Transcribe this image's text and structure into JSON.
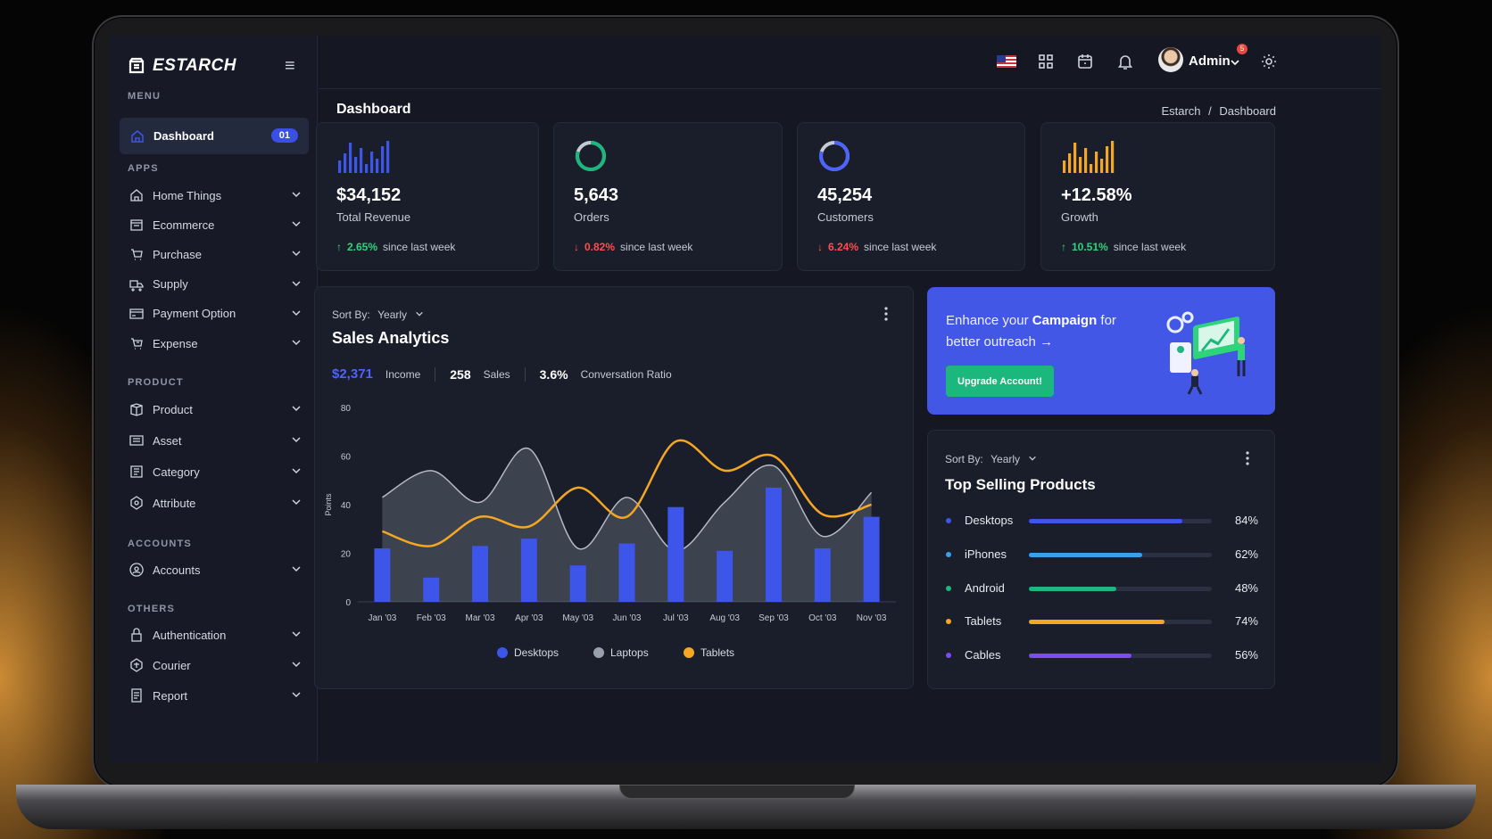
{
  "app": {
    "brand": "ESTARCH"
  },
  "sidebar": {
    "menu_label": "MENU",
    "dashboard": {
      "label": "Dashboard",
      "badge": "01"
    },
    "apps_label": "APPS",
    "apps": [
      "Home Things",
      "Ecommerce",
      "Purchase",
      "Supply",
      "Payment Option",
      "Expense"
    ],
    "product_label": "PRODUCT",
    "product": [
      "Product",
      "Asset",
      "Category",
      "Attribute"
    ],
    "accounts_label": "ACCOUNTS",
    "accounts": [
      "Accounts"
    ],
    "others_label": "OTHERS",
    "others": [
      "Authentication",
      "Courier",
      "Report"
    ]
  },
  "topbar": {
    "notification_count": "5",
    "user_name": "Admin"
  },
  "page": {
    "title": "Dashboard",
    "breadcrumb": {
      "root": "Estarch",
      "sep": "/",
      "current": "Dashboard"
    }
  },
  "stats": [
    {
      "value": "$34,152",
      "label": "Total Revenue",
      "change": "2.65%",
      "direction": "up",
      "suffix": "since last week",
      "icon": "bar-chart-icon"
    },
    {
      "value": "5,643",
      "label": "Orders",
      "change": "0.82%",
      "direction": "down",
      "suffix": "since last week",
      "icon": "donut-icon"
    },
    {
      "value": "45,254",
      "label": "Customers",
      "change": "6.24%",
      "direction": "down",
      "suffix": "since last week",
      "icon": "donut-icon"
    },
    {
      "value": "+12.58%",
      "label": "Growth",
      "change": "10.51%",
      "direction": "up",
      "suffix": "since last week",
      "icon": "bar-chart-icon"
    }
  ],
  "sales": {
    "sort_label": "Sort By:",
    "sort_value": "Yearly",
    "title": "Sales Analytics",
    "income_value": "$2,371",
    "income_label": "Income",
    "sales_value": "258",
    "sales_label": "Sales",
    "ratio_value": "3.6%",
    "ratio_label": "Conversation Ratio"
  },
  "chart_data": {
    "type": "bar",
    "ylabel": "Points",
    "ylim": [
      0,
      80
    ],
    "yticks": [
      0,
      20,
      40,
      60,
      80
    ],
    "categories": [
      "Jan '03",
      "Feb '03",
      "Mar '03",
      "Apr '03",
      "May '03",
      "Jun '03",
      "Jul '03",
      "Aug '03",
      "Sep '03",
      "Oct '03",
      "Nov '03"
    ],
    "series": [
      {
        "name": "Desktops",
        "type": "bar",
        "color": "#3d55e8",
        "values": [
          22,
          10,
          23,
          26,
          15,
          24,
          39,
          21,
          47,
          22,
          35
        ]
      },
      {
        "name": "Laptops",
        "type": "area",
        "color": "#9aa0ad",
        "values": [
          43,
          54,
          41,
          63,
          22,
          43,
          21,
          41,
          56,
          27,
          45
        ]
      },
      {
        "name": "Tablets",
        "type": "line",
        "color": "#f5a623",
        "values": [
          29,
          23,
          35,
          31,
          47,
          35,
          66,
          54,
          60,
          36,
          40
        ]
      }
    ],
    "legend_position": "bottom"
  },
  "promo": {
    "text_pre": "Enhance your ",
    "text_bold": "Campaign",
    "text_post": " for better outreach →",
    "button": "Upgrade Account!"
  },
  "top_products": {
    "sort_label": "Sort By:",
    "sort_value": "Yearly",
    "title": "Top Selling Products",
    "items": [
      {
        "name": "Desktops",
        "pct": "84%",
        "value": 0.84,
        "color": "#3d55e8"
      },
      {
        "name": "iPhones",
        "pct": "62%",
        "value": 0.62,
        "color": "#3aa0e8"
      },
      {
        "name": "Android",
        "pct": "48%",
        "value": 0.48,
        "color": "#1bb77c"
      },
      {
        "name": "Tablets",
        "pct": "74%",
        "value": 0.74,
        "color": "#f5a623"
      },
      {
        "name": "Cables",
        "pct": "56%",
        "value": 0.56,
        "color": "#7b4cf0"
      }
    ]
  }
}
